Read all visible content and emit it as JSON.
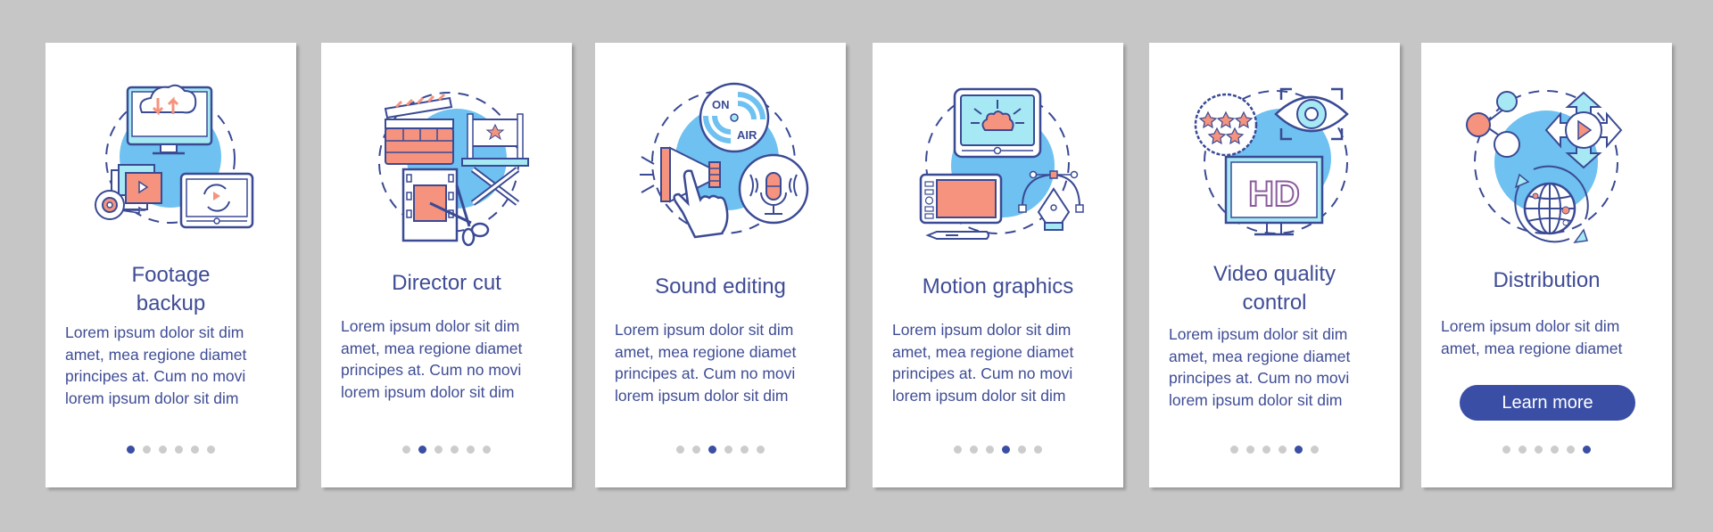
{
  "colors": {
    "background": "#c6c6c6",
    "card": "#ffffff",
    "text": "#3f4c95",
    "accent": "#3a4ea6",
    "dot_inactive": "#cccccc",
    "illustration_blue": "#6ec1f0",
    "illustration_salmon": "#f5937e",
    "illustration_cyan": "#a6e9f5",
    "illustration_outline": "#3a4a94"
  },
  "cards": [
    {
      "title": "Footage\nbackup",
      "title_lines": [
        "Footage",
        "backup"
      ],
      "body": "Lorem ipsum dolor sit dim\namet, mea regione diamet\nprincipes at. Cum no movi\nlorem ipsum dolor sit dim",
      "icon": "footage-backup-illustration",
      "page_index": 1
    },
    {
      "title": "Director cut",
      "title_lines": [
        "Director cut"
      ],
      "body": "Lorem ipsum dolor sit dim\namet, mea regione diamet\nprincipes at. Cum no movi\nlorem ipsum dolor sit dim",
      "icon": "director-cut-illustration",
      "page_index": 2
    },
    {
      "title": "Sound editing",
      "title_lines": [
        "Sound editing"
      ],
      "body": "Lorem ipsum dolor sit dim\namet, mea regione diamet\nprincipes at. Cum no movi\nlorem ipsum dolor sit dim",
      "icon": "sound-editing-illustration",
      "icon_text": {
        "on": "ON",
        "air": "AIR"
      },
      "page_index": 3
    },
    {
      "title": "Motion graphics",
      "title_lines": [
        "Motion graphics"
      ],
      "body": "Lorem ipsum dolor sit dim\namet, mea regione diamet\nprincipes at. Cum no movi\nlorem ipsum dolor sit dim",
      "icon": "motion-graphics-illustration",
      "page_index": 4
    },
    {
      "title": "Video quality\ncontrol",
      "title_lines": [
        "Video quality",
        "control"
      ],
      "body": "Lorem ipsum dolor sit dim\namet, mea regione diamet\nprincipes at. Cum no movi\nlorem ipsum dolor sit dim",
      "icon": "video-quality-control-illustration",
      "icon_text": {
        "hd": "HD"
      },
      "page_index": 5
    },
    {
      "title": "Distribution",
      "title_lines": [
        "Distribution"
      ],
      "body": "Lorem ipsum dolor sit dim\namet, mea regione diamet",
      "icon": "distribution-illustration",
      "button_label": "Learn more",
      "page_index": 6
    }
  ],
  "pagination": {
    "total_pages": 6
  }
}
